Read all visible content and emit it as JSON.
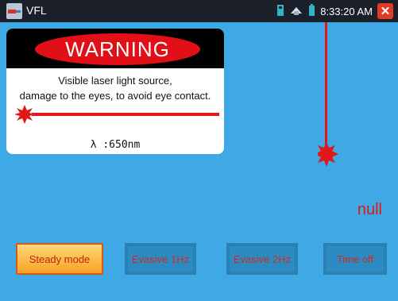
{
  "titlebar": {
    "title": "VFL",
    "time": "8:33:20 AM",
    "icons": [
      "sd-card-icon",
      "connection-icon",
      "battery-icon"
    ],
    "close_label": "✕"
  },
  "warning_card": {
    "heading": "WARNING",
    "line1": "Visible laser light source,",
    "line2": "damage to the eyes, to avoid eye contact.",
    "wavelength": "λ :650nm"
  },
  "status": {
    "value": "null"
  },
  "modes": {
    "steady": "Steady mode",
    "evasive1": "Evasive 1Hz",
    "evasive2": "Evasive 2Hz",
    "timeoff": "Time off"
  },
  "colors": {
    "background": "#3fa9e6",
    "titlebar": "#1a1f29",
    "laser_red": "#e01818",
    "active_button": "#f7a324"
  }
}
